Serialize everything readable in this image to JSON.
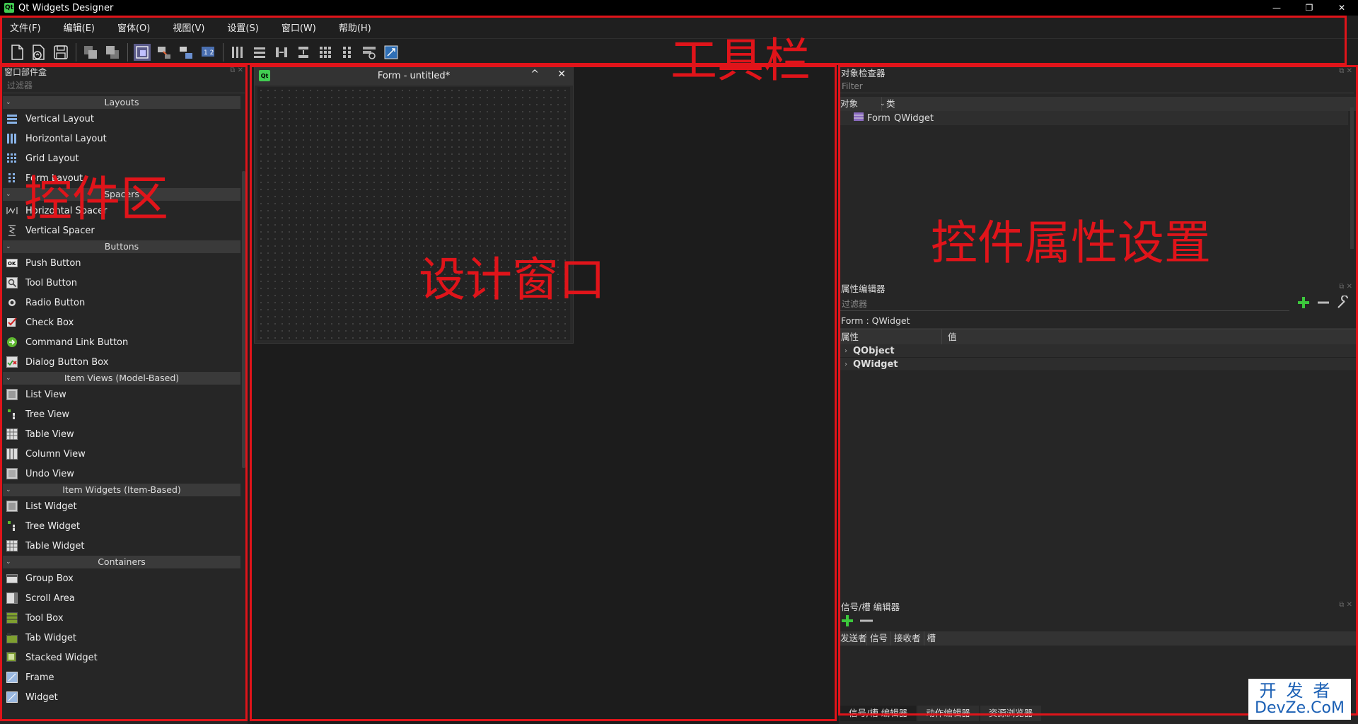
{
  "window": {
    "title": "Qt Widgets Designer",
    "logo": "Qt",
    "minimize": "—",
    "maximize": "❐",
    "close": "✕"
  },
  "menu": [
    "文件(F)",
    "编辑(E)",
    "窗体(O)",
    "视图(V)",
    "设置(S)",
    "窗口(W)",
    "帮助(H)"
  ],
  "toolbar_icons": [
    "new-form-icon",
    "open-form-icon",
    "save-form-icon",
    "send-to-back-icon",
    "bring-to-front-icon",
    "edit-widgets-icon",
    "edit-signals-slots-icon",
    "edit-buddies-icon",
    "edit-tab-order-icon",
    "layout-horizontal-icon",
    "layout-vertical-icon",
    "layout-horizontal-splitter-icon",
    "layout-vertical-splitter-icon",
    "layout-grid-icon",
    "layout-form-icon",
    "break-layout-icon",
    "adjust-size-icon"
  ],
  "widget_box": {
    "title": "窗口部件盒",
    "filter_placeholder": "过滤器",
    "categories": [
      {
        "name": "Layouts",
        "items": [
          "Vertical Layout",
          "Horizontal Layout",
          "Grid Layout",
          "Form Layout"
        ]
      },
      {
        "name": "Spacers",
        "items": [
          "Horizontal Spacer",
          "Vertical Spacer"
        ]
      },
      {
        "name": "Buttons",
        "items": [
          "Push Button",
          "Tool Button",
          "Radio Button",
          "Check Box",
          "Command Link Button",
          "Dialog Button Box"
        ]
      },
      {
        "name": "Item Views (Model-Based)",
        "items": [
          "List View",
          "Tree View",
          "Table View",
          "Column View",
          "Undo View"
        ]
      },
      {
        "name": "Item Widgets (Item-Based)",
        "items": [
          "List Widget",
          "Tree Widget",
          "Table Widget"
        ]
      },
      {
        "name": "Containers",
        "items": [
          "Group Box",
          "Scroll Area",
          "Tool Box",
          "Tab Widget",
          "Stacked Widget",
          "Frame",
          "Widget"
        ]
      }
    ]
  },
  "form": {
    "title": "Form - untitled*",
    "logo": "Qt",
    "collapse": "^",
    "close": "✕"
  },
  "object_inspector": {
    "title": "对象检查器",
    "filter_placeholder": "Filter",
    "col_object": "对象",
    "col_class": "类",
    "row_object": "Form",
    "row_class": "QWidget"
  },
  "property_editor": {
    "title": "属性编辑器",
    "filter_placeholder": "过滤器",
    "class_line": "Form : QWidget",
    "col_property": "属性",
    "col_value": "值",
    "groups": [
      "QObject",
      "QWidget"
    ]
  },
  "signal_slot_editor": {
    "title": "信号/槽 编辑器",
    "col_sender": "发送者",
    "col_signal": "信号",
    "col_receiver": "接收者",
    "col_slot": "槽"
  },
  "bottom_tabs": [
    "信号/槽 编辑器",
    "动作编辑器",
    "资源浏览器"
  ],
  "annotations": {
    "toolbar": "工具栏",
    "widgets": "控件区",
    "design": "设计窗口",
    "properties": "控件属性设置"
  },
  "watermark": {
    "top": "开发者",
    "bottom": "DevZe.CoM"
  },
  "colors": {
    "annotation_red": "#e0141a",
    "qt_green": "#41cd52",
    "add_green": "#3cc83c",
    "watermark_blue": "#1a5fb4"
  }
}
